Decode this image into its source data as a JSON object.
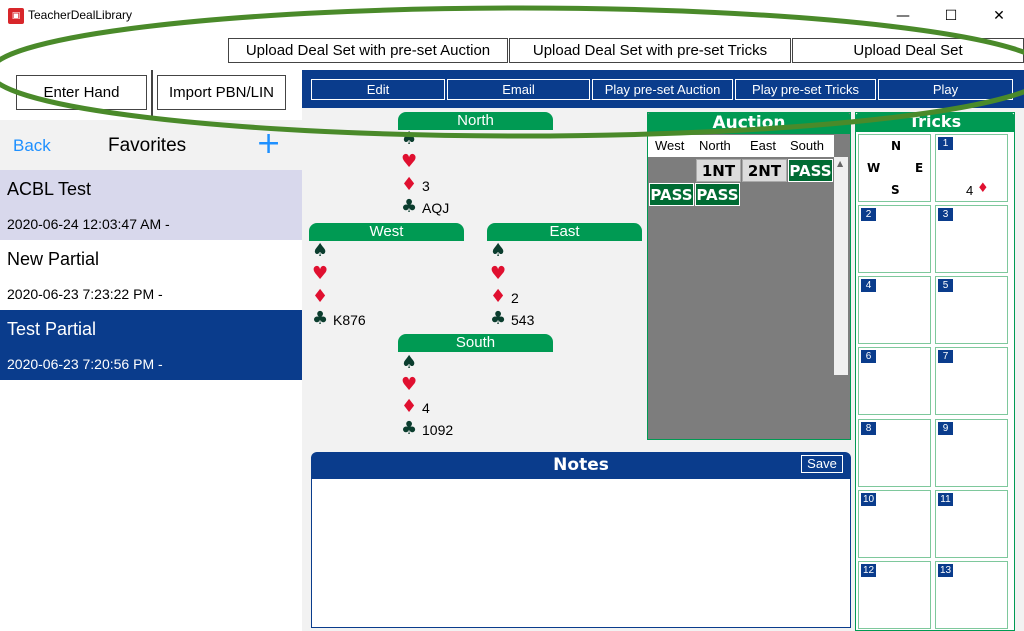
{
  "window": {
    "title": "TeacherDealLibrary",
    "minimize": "—",
    "maximize": "☐",
    "close": "✕"
  },
  "upload": {
    "auction_label": "Upload Deal Set with pre-set Auction",
    "tricks_label": "Upload Deal Set with pre-set Tricks",
    "deal_label": "Upload Deal Set"
  },
  "left": {
    "enter_hand": "Enter Hand",
    "import": "Import PBN/LIN",
    "back": "Back",
    "title": "Favorites",
    "add": "+",
    "items": [
      {
        "name": "ACBL Test",
        "date": "2020-06-24 12:03:47 AM -",
        "state": "highlighted"
      },
      {
        "name": "New Partial",
        "date": "2020-06-23 7:23:22 PM -",
        "state": "normal"
      },
      {
        "name": "Test Partial",
        "date": "2020-06-23 7:20:56 PM -",
        "state": "selected"
      }
    ]
  },
  "toolbar": {
    "edit": "Edit",
    "email": "Email",
    "play_auction": "Play pre-set Auction",
    "play_tricks": "Play pre-set Tricks",
    "play": "Play"
  },
  "hands": {
    "north": {
      "label": "North",
      "spades": "",
      "hearts": "",
      "diamonds": "3",
      "clubs": "AQJ"
    },
    "west": {
      "label": "West",
      "spades": "",
      "hearts": "",
      "diamonds": "",
      "clubs": "K876"
    },
    "east": {
      "label": "East",
      "spades": "",
      "hearts": "",
      "diamonds": "2",
      "clubs": "543"
    },
    "south": {
      "label": "South",
      "spades": "",
      "hearts": "",
      "diamonds": "4",
      "clubs": "1092"
    }
  },
  "suit_symbols": {
    "spade": "♠",
    "heart": "♥",
    "diamond": "♦",
    "club": "♣"
  },
  "auction": {
    "title": "Auction",
    "seats": [
      "West",
      "North",
      "East",
      "South"
    ],
    "bids": [
      "1NT",
      "2NT",
      "PASS",
      "PASS",
      "PASS"
    ]
  },
  "tricks": {
    "title": "Tricks",
    "compass": {
      "n": "N",
      "w": "W",
      "e": "E",
      "s": "S"
    },
    "trick1": "4",
    "numbers": [
      "1",
      "2",
      "3",
      "4",
      "5",
      "6",
      "7",
      "8",
      "9",
      "10",
      "11",
      "12",
      "13"
    ]
  },
  "notes": {
    "title": "Notes",
    "save": "Save",
    "value": ""
  },
  "colors": {
    "navy": "#0a3c8c",
    "green": "#009a53",
    "dark_green": "#006b33",
    "oval": "#4a8a2a",
    "link": "#1e90ff"
  }
}
